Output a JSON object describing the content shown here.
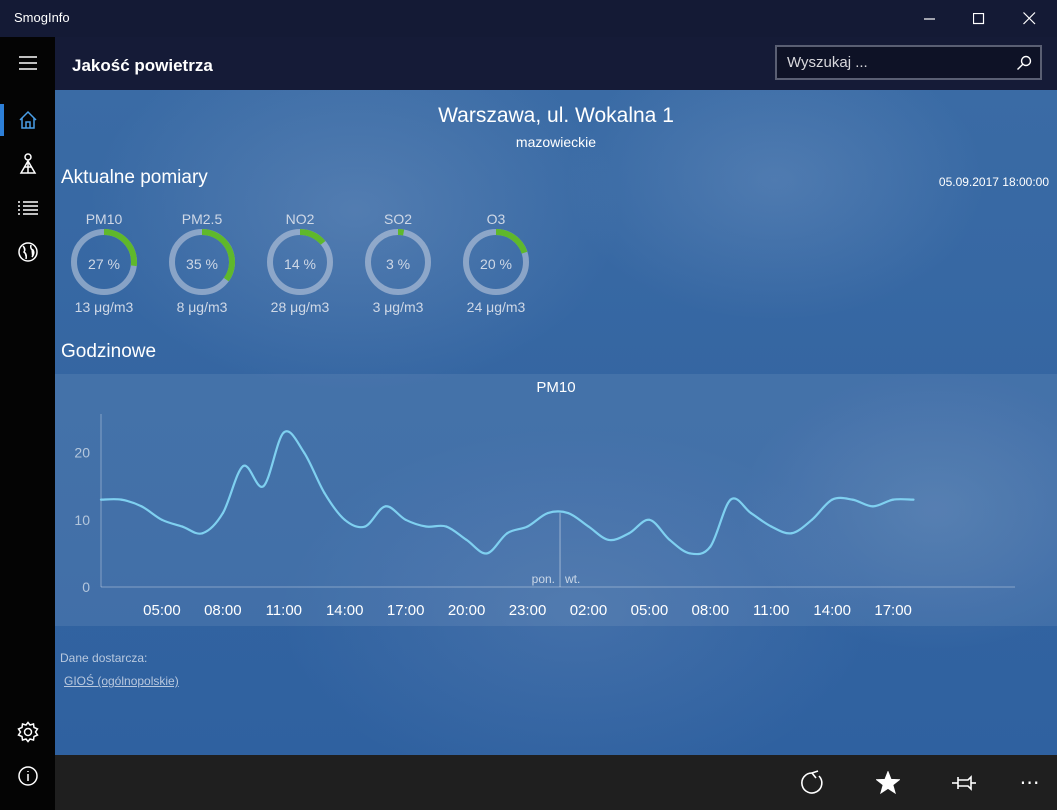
{
  "window": {
    "app_title": "SmogInfo",
    "controls": [
      "minimize",
      "maximize",
      "close"
    ]
  },
  "nav": {
    "items": [
      {
        "icon": "home-icon",
        "active": true
      },
      {
        "icon": "station-icon",
        "active": false
      },
      {
        "icon": "list-icon",
        "active": false
      },
      {
        "icon": "globe-icon",
        "active": false
      }
    ],
    "bottom_items": [
      {
        "icon": "settings-icon"
      },
      {
        "icon": "info-icon"
      }
    ]
  },
  "header": {
    "title": "Jakość powietrza",
    "search_placeholder": "Wyszukaj ..."
  },
  "location": {
    "city": "Warszawa, ul. Wokalna 1",
    "region": "mazowieckie"
  },
  "current": {
    "section_title": "Aktualne pomiary",
    "timestamp": "05.09.2017 18:00:00",
    "pollutants": [
      {
        "name": "PM10",
        "percent_label": "27 %",
        "percent": 27,
        "value": "13 μg/m3",
        "selected": true
      },
      {
        "name": "PM2.5",
        "percent_label": "35 %",
        "percent": 35,
        "value": "8 μg/m3",
        "selected": false
      },
      {
        "name": "NO2",
        "percent_label": "14 %",
        "percent": 14,
        "value": "28 μg/m3",
        "selected": false
      },
      {
        "name": "SO2",
        "percent_label": "3 %",
        "percent": 3,
        "value": "3 μg/m3",
        "selected": false
      },
      {
        "name": "O3",
        "percent_label": "20 %",
        "percent": 20,
        "value": "24 μg/m3",
        "selected": false
      }
    ],
    "ring_color": "#5fb82b"
  },
  "hourly": {
    "section_title": "Godzinowe"
  },
  "chart_data": {
    "type": "line",
    "title": "PM10",
    "ylim": [
      0,
      25
    ],
    "yticks": [
      0,
      10,
      20
    ],
    "xlim": [
      0,
      45
    ],
    "x_tick_positions": [
      3,
      6,
      9,
      12,
      15,
      18,
      21,
      24,
      27,
      30,
      33,
      36,
      39,
      42
    ],
    "x_tick_labels": [
      "05:00",
      "08:00",
      "11:00",
      "14:00",
      "17:00",
      "20:00",
      "23:00",
      "02:00",
      "05:00",
      "08:00",
      "11:00",
      "14:00",
      "17:00"
    ],
    "day_divider": {
      "x": 22.6,
      "left_label": "pon.",
      "right_label": "wt."
    },
    "series": [
      {
        "color": "#7fd0f0",
        "x": [
          0,
          1,
          2,
          3,
          4,
          5,
          6,
          7,
          8,
          9,
          10,
          11,
          12,
          13,
          14,
          15,
          16,
          17,
          18,
          19,
          20,
          21,
          22,
          23,
          24,
          25,
          26,
          27,
          28,
          29,
          30,
          31,
          32,
          33,
          34,
          35,
          36,
          37,
          38,
          39,
          40
        ],
        "y": [
          13,
          13,
          12,
          10,
          9,
          8,
          11,
          18,
          15,
          23,
          20,
          14,
          10,
          9,
          12,
          10,
          9,
          9,
          7,
          5,
          8,
          9,
          11,
          11,
          9,
          7,
          8,
          10,
          7,
          5,
          6,
          13,
          11,
          9,
          8,
          10,
          13,
          13,
          12,
          13,
          13
        ]
      }
    ]
  },
  "provider": {
    "label": "Dane dostarcza:",
    "link": "GIOŚ (ogólnopolskie)"
  },
  "appbar": {
    "buttons": [
      "refresh-icon",
      "star-icon",
      "pin-icon"
    ],
    "more": "⋯"
  }
}
